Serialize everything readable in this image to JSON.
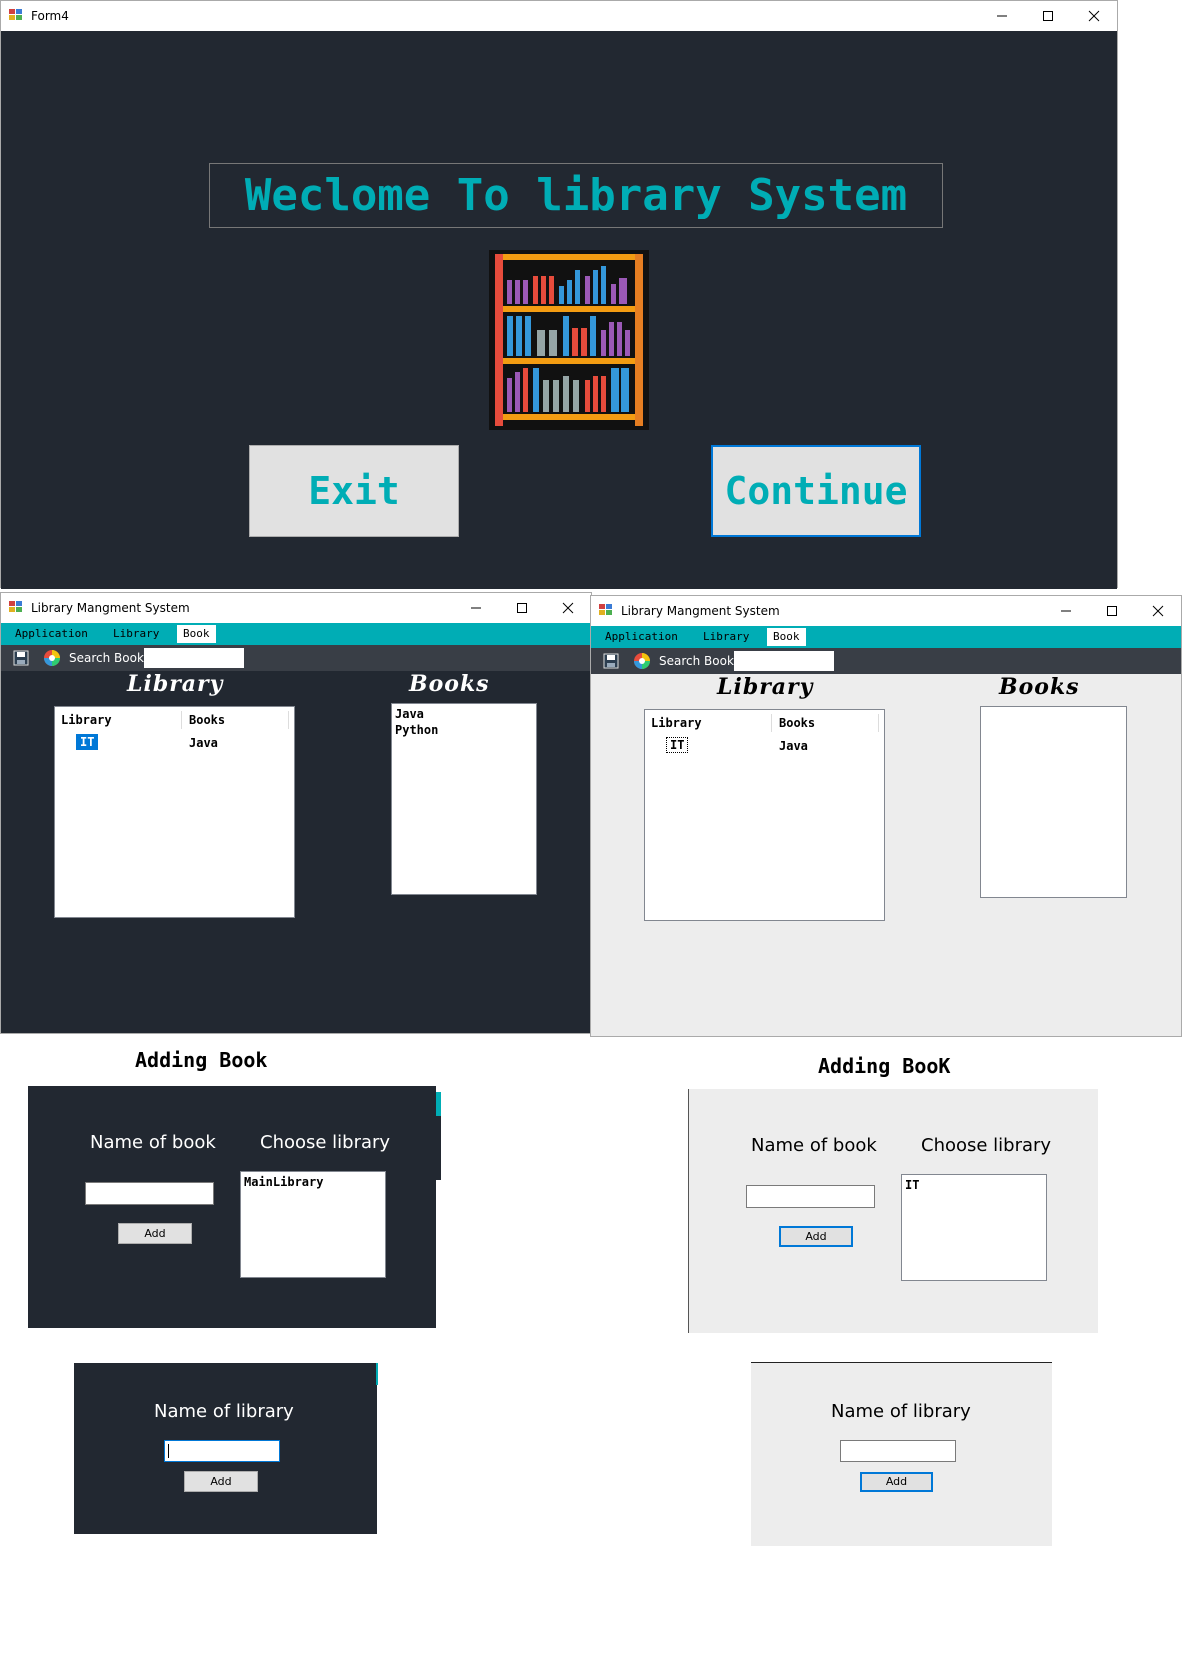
{
  "form4": {
    "title": "Form4",
    "welcome_text": "Weclome To library System",
    "exit_label": "Exit",
    "continue_label": "Continue"
  },
  "main_dark": {
    "title": "Library Mangment System",
    "menu": [
      "Application",
      "Library",
      "Book"
    ],
    "search_label": "Search Book",
    "library_heading": "Library",
    "books_heading": "Books",
    "columns": [
      "Library",
      "Books"
    ],
    "rows": [
      [
        "IT",
        "Java"
      ]
    ],
    "books": [
      "Java",
      "Python"
    ]
  },
  "main_light": {
    "title": "Library Mangment System",
    "menu": [
      "Application",
      "Library",
      "Book"
    ],
    "search_label": "Search Book",
    "library_heading": "Library",
    "books_heading": "Books",
    "columns": [
      "Library",
      "Books"
    ],
    "rows": [
      [
        "IT",
        "Java"
      ]
    ],
    "books": []
  },
  "adding_dark": {
    "heading": "Adding Book",
    "name_label": "Name of book",
    "choose_label": "Choose library",
    "add_label": "Add",
    "libraries": [
      "MainLibrary"
    ]
  },
  "adding_light": {
    "heading": "Adding BooK",
    "name_label": "Name of book",
    "choose_label": "Choose library",
    "add_label": "Add",
    "libraries": [
      "IT"
    ]
  },
  "lib_dark": {
    "name_label": "Name of library",
    "add_label": "Add"
  },
  "lib_light": {
    "name_label": "Name of library",
    "add_label": "Add"
  },
  "colors": {
    "dark_bg": "#222831",
    "accent": "#00adb5",
    "toolbar": "#393e46",
    "light_bg": "#ededed",
    "selection": "#0078d7"
  }
}
